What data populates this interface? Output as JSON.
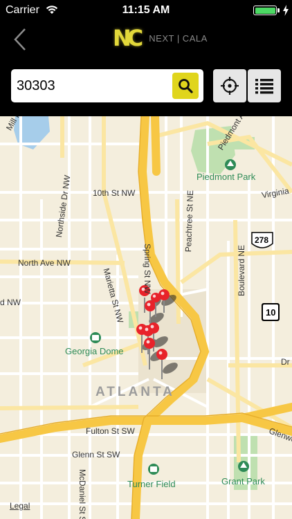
{
  "status_bar": {
    "carrier": "Carrier",
    "time": "11:15 AM"
  },
  "nav_bar": {
    "logo_mark": "NC",
    "logo_text": "NEXT | CALA"
  },
  "search": {
    "value": "30303"
  },
  "map": {
    "legal_link": "Legal",
    "labels": {
      "mill_rd": "Mill Rd NW",
      "tenth_st": "10th St NW",
      "northside_dr": "Northside Dr NW",
      "spring_st": "Spring St NW",
      "peachtree_st": "Peachtree St NE",
      "piedmont_ave": "Piedmont Ave",
      "virginia": "Virginia",
      "north_ave": "North Ave NW",
      "marietta_st": "Marietta St NW",
      "boulevard": "Boulevard NE",
      "nw_fragment": "d NW",
      "dr_fragment": "Dr",
      "fulton_st": "Fulton St SW",
      "glenn_st": "Glenn St SW",
      "mcdaniel_st": "McDaniel St SW",
      "glenwood": "Glenwo",
      "atlanta": "ATLANTA",
      "shield_278": "278",
      "shield_10": "10"
    },
    "poi": {
      "piedmont_park": "Piedmont Park",
      "georgia_dome": "Georgia Dome",
      "turner_field": "Turner Field",
      "grant_park": "Grant Park"
    },
    "pin_count": 9
  },
  "colors": {
    "accent_yellow": "#e0d51c",
    "pin_red": "#e8232a",
    "highway": "#f7c744",
    "park_green": "#bfe0b0",
    "water": "#a6cdea"
  }
}
